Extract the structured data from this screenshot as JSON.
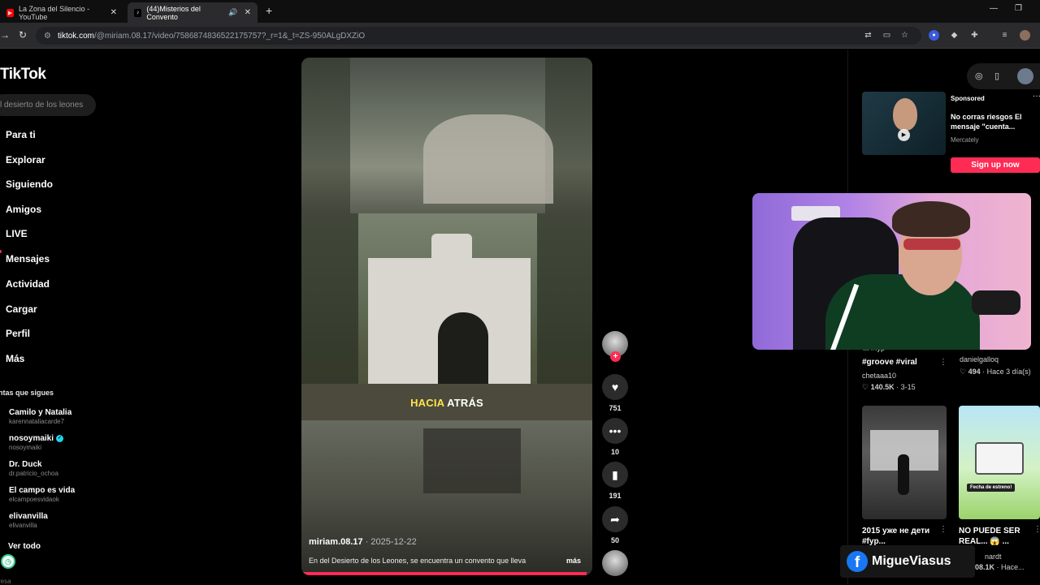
{
  "browser": {
    "tabs": [
      {
        "title": "La Zona del Silencio - YouTube",
        "favicon": "youtube-icon",
        "active": false
      },
      {
        "title": "(44)Misterios del Convento",
        "favicon": "tiktok-icon",
        "active": true
      }
    ],
    "url_host": "tiktok.com",
    "url_path": "/@miriam.08.17/video/7586874836522175757?_r=1&_t=ZS-950ALgDXZiO"
  },
  "sidebar": {
    "logo": "TikTok",
    "search_placeholder": "l desierto de los leones",
    "nav": [
      "Para ti",
      "Explorar",
      "Siguiendo",
      "Amigos",
      "LIVE",
      "Mensajes",
      "Actividad",
      "Cargar",
      "Perfil",
      "Más"
    ],
    "following_title": "ntas que sigues",
    "accounts": [
      {
        "name": "Camilo y Natalia",
        "user": "karennataliacarde7",
        "verified": false
      },
      {
        "name": "nosoymaiki",
        "user": "nosoymaiki",
        "verified": true
      },
      {
        "name": "Dr. Duck",
        "user": "dr.patricio_ochoa",
        "verified": false
      },
      {
        "name": "El campo es vida",
        "user": "elcampoesvidaok",
        "verified": false
      },
      {
        "name": "elivanvilla",
        "user": "elivanvilla",
        "verified": false
      }
    ],
    "see_all": "Ver todo",
    "bottom_text": "resa"
  },
  "video": {
    "overlay_highlight": "HACIA",
    "overlay_text": " ATRÁS",
    "author": "miriam.08.17",
    "date": " · 2025-12-22",
    "description": "En del Desierto de los Leones, se encuentra un convento que lleva",
    "more": "más",
    "progress": 0.98,
    "likes": "751",
    "comments": "10",
    "saves": "191",
    "shares": "50"
  },
  "ad": {
    "sponsored": "Sponsored",
    "title": "No corras riesgos El mensaje \"cuenta...",
    "brand": "Mercately",
    "cta": "Sign up now"
  },
  "feed": [
    {
      "title": "#groove #viral",
      "author": "chetaaa10",
      "likes": "140.5K",
      "extra": "3-15"
    },
    {
      "title": "",
      "author": "danielgalloq",
      "likes": "494",
      "extra": "Hace 3 día(s)"
    },
    {
      "title": "2015 уже не дети #fyp...",
      "author": "",
      "likes": "",
      "extra": ""
    },
    {
      "title": "NO PUEDE SER REAL... 😱 ...",
      "author": "nardt",
      "likes": "08.1K",
      "extra": "Hace..."
    }
  ],
  "feed_badge": "Fecha de estreno!",
  "feed_partial_top": "... #fyp>",
  "watermark": "MigueViasus",
  "colors": {
    "accent": "#fe2c55",
    "facebook": "#1877f2",
    "highlight": "#ffe44d"
  }
}
